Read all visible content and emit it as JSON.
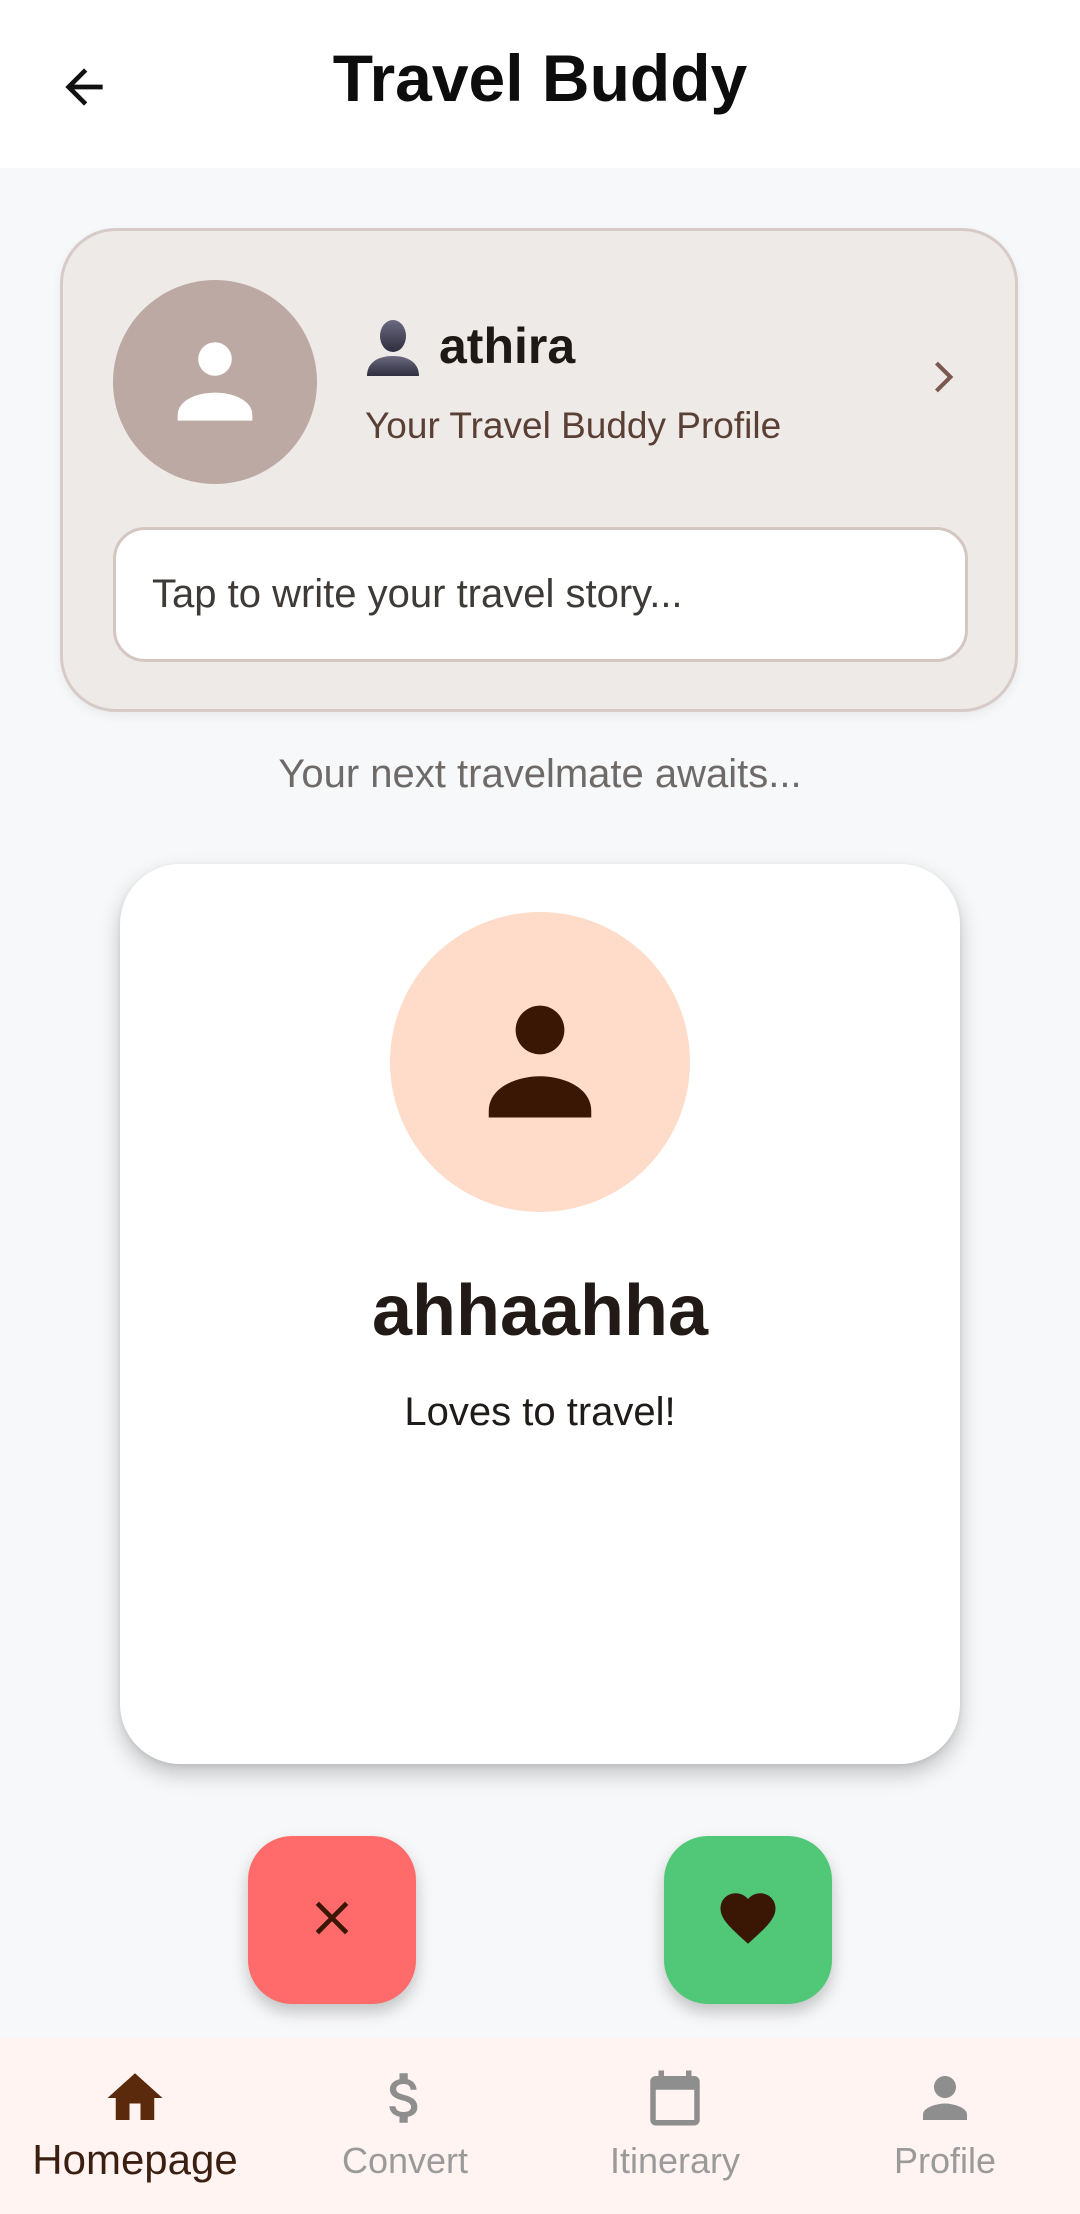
{
  "app_bar": {
    "title": "Travel Buddy"
  },
  "profile_card": {
    "emoji": "👤",
    "name": "athira",
    "subtitle": "Your Travel Buddy Profile",
    "story_placeholder": "Tap to write your travel story..."
  },
  "awaits_text": "Your next travelmate awaits...",
  "match_card": {
    "name": "ahhaahha",
    "bio": "Loves to travel!"
  },
  "actions": {
    "reject_icon": "close-icon",
    "like_icon": "heart-icon"
  },
  "bottom_nav": {
    "items": [
      {
        "label": "Homepage",
        "icon": "home-icon",
        "active": true
      },
      {
        "label": "Convert",
        "icon": "dollar-icon",
        "active": false
      },
      {
        "label": "Itinerary",
        "icon": "calendar-icon",
        "active": false
      },
      {
        "label": "Profile",
        "icon": "person-icon",
        "active": false
      }
    ]
  },
  "colors": {
    "brand_dark": "#3b1f10",
    "reject": "#ff6b6b",
    "like": "#51c878",
    "profile_card_bg": "#eeeae7",
    "match_avatar_bg": "#fedcc9"
  }
}
